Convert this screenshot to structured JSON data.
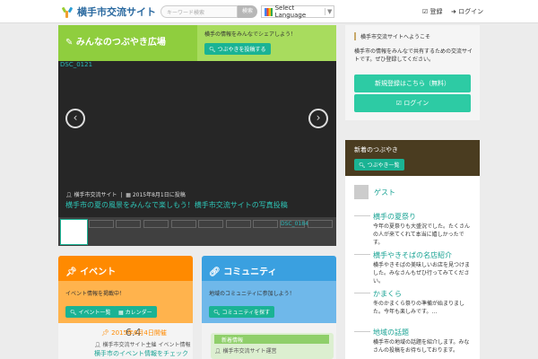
{
  "header": {
    "site_title": "横手市交流サイト",
    "search_placeholder": "キーワード検索",
    "search_button": "検索",
    "language_label": "Select Language",
    "login_label": "登録",
    "logout_label": "ログイン"
  },
  "hero": {
    "title": "みんなのつぶやき広場",
    "description": "横手の情報をみんなでシェアしよう！",
    "button": "つぶやきを投稿する"
  },
  "slider": {
    "image_label": "DSC_0121",
    "author": "横手市交流サイト",
    "date": "2015年8月1日に投稿",
    "caption": "横手市の夏の風景をみんなで楽しもう！横手市交流サイトの写真投稿",
    "thumb_label": "DSC_0184"
  },
  "cards": [
    {
      "title": "イベント",
      "description": "イベント情報を掲載中！",
      "buttons": [
        "イベント一覧",
        "カレンダー"
      ],
      "badge": "6.4",
      "date_label": "2015年6月4日開催",
      "meta": "横手市交流サイト主催 イベント情報",
      "link": "横手市のイベント情報をチェックしよう"
    },
    {
      "title": "コミュニティ",
      "description": "地域のコミュニティに参加しよう！",
      "button": "コミュニティを探す",
      "sub_label": "新着情報",
      "meta": "横手市交流サイト運営"
    }
  ],
  "sidebar": {
    "note": "横手市交流サイトへようこそ",
    "text": "横手市の情報をみんなで共有するための交流サイトです。ぜひ登録してください。",
    "buttons": [
      "新規登録はこちら（無料）",
      "ログイン"
    ],
    "section_title": "新着のつぶやき",
    "section_button": "つぶやき一覧",
    "user": "ゲスト",
    "items": [
      {
        "title": "横手の夏祭り",
        "text": "今年の夏祭りも大盛況でした。たくさんの人が来てくれて本当に嬉しかったです。"
      },
      {
        "title": "横手やきそばの名店紹介",
        "text": "横手やきそばの美味しいお店を見つけました。みなさんもぜひ行ってみてください。"
      },
      {
        "title": "かまくら",
        "text": "冬のかまくら祭りの準備が始まりました。今年も楽しみです。…"
      },
      {
        "title": "地域の話題",
        "text": "横手市の地域の話題を紹介します。みなさんの投稿をお待ちしております。"
      }
    ]
  },
  "colors": {
    "accent_teal": "#1ab394",
    "hero_green": "#8fce3e",
    "orange": "#ff8a00",
    "blue": "#3aa0e0",
    "brown": "#4a3c20"
  }
}
